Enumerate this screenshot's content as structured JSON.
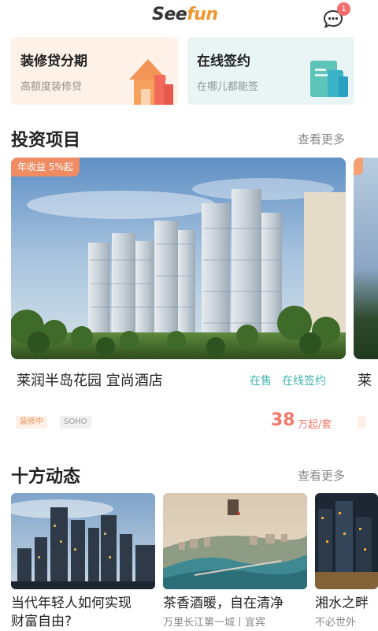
{
  "header": {
    "logo_part1": "See",
    "logo_part2": "fun",
    "message_badge": "1"
  },
  "top_cards": [
    {
      "title": "装修贷分期",
      "subtitle": "高额度装修贷"
    },
    {
      "title": "在线签约",
      "subtitle": "在哪儿都能签"
    }
  ],
  "investment": {
    "section_title": "投资项目",
    "more_label": "查看更多",
    "project": {
      "yield_tag": "年收益 5%起",
      "name": "莱润半岛花园 宜尚酒店",
      "status": "在售",
      "sign_label": "在线签约",
      "tags": [
        "装修中",
        "SOHO"
      ],
      "price_value": "38",
      "price_unit": "万起/套"
    },
    "peek_name": "莱"
  },
  "news": {
    "section_title": "十方动态",
    "more_label": "查看更多",
    "items": [
      {
        "title": "当代年轻人如何实现",
        "title2": "财富自由?",
        "subtitle": ""
      },
      {
        "title": "茶香酒暖，自在清净",
        "subtitle": "万里长江第一城丨宜宾"
      },
      {
        "title": "湘水之畔",
        "subtitle": "不必世外"
      }
    ]
  },
  "colors": {
    "accent_orange": "#f0962e",
    "accent_teal": "#3fb3ad",
    "price_red": "#f07a6a"
  }
}
